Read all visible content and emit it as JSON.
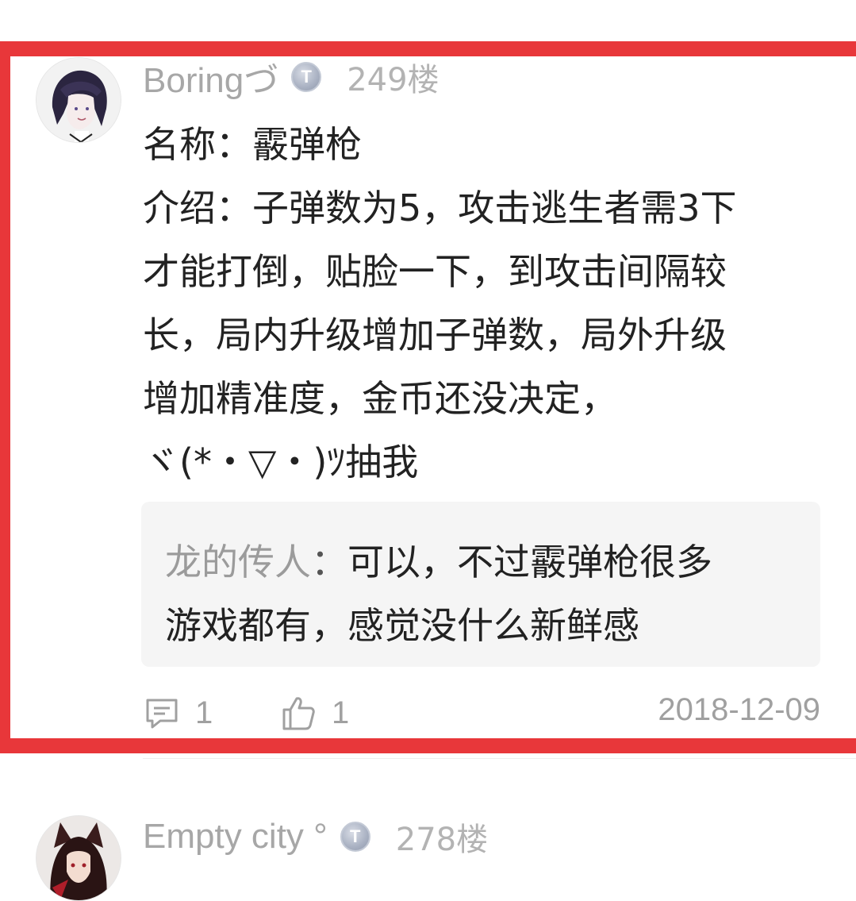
{
  "comments": [
    {
      "username": "Boringづ",
      "badge": "T",
      "floor": "249楼",
      "body_lines": [
        "名称：霰弹枪",
        "介绍：子弹数为5，攻击逃生者需3下",
        "才能打倒，贴脸一下，到攻击间隔较",
        "长，局内升级增加子弹数，局外升级",
        "增加精准度，金币还没决定，",
        "ヾ(*・▽・)ﾂ抽我"
      ],
      "reply": {
        "author": "龙的传人",
        "colon": "：",
        "line1": "可以，不过霰弹枪很多",
        "line2": "游戏都有，感觉没什么新鲜感"
      },
      "reply_count": "1",
      "like_count": "1",
      "date": "2018-12-09"
    },
    {
      "username": "Empty city °",
      "badge": "T",
      "floor": "278楼"
    }
  ],
  "colors": {
    "highlight": "#e8373a",
    "meta_text": "#a7a7a7",
    "reply_bg": "#f5f5f5"
  },
  "icons": {
    "reply": "comment-icon",
    "like": "thumbs-up-icon",
    "badge": "level-badge-icon"
  }
}
